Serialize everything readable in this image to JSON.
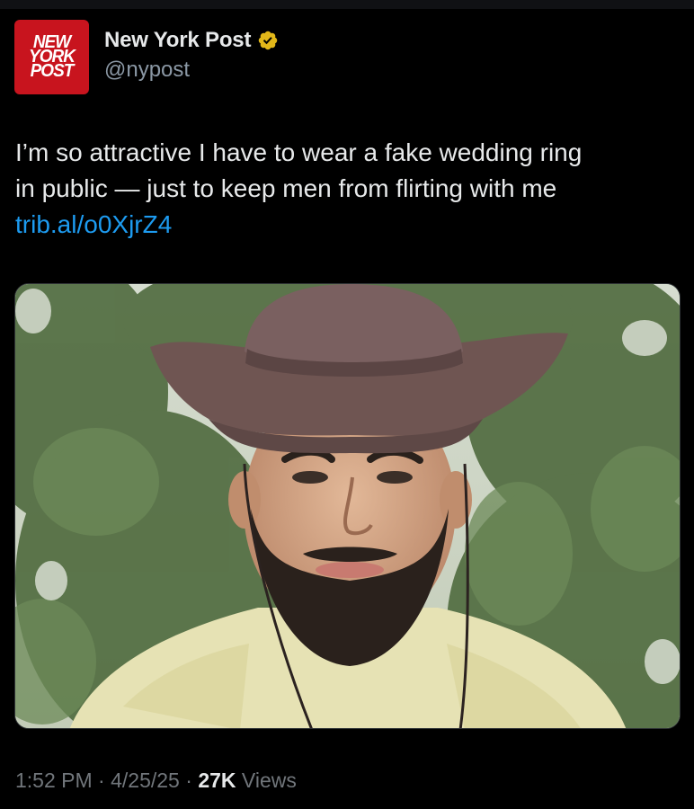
{
  "author": {
    "avatar_lines": [
      "NEW",
      "YORK",
      "POST"
    ],
    "display_name": "New York Post",
    "handle": "@nypost",
    "verified_icon": "verified-badge-gold",
    "avatar_color": "#c8141e"
  },
  "tweet": {
    "text_lines": [
      "I’m so attractive I have to wear a fake wedding ring",
      "in public — just to keep men from flirting with me"
    ],
    "link": "trib.al/o0XjrZ4"
  },
  "meta": {
    "time": "1:52 PM",
    "date": "4/25/25",
    "separator": "·",
    "views_count": "27K",
    "views_label": "Views"
  },
  "colors": {
    "background": "#000000",
    "text": "#e7e9ea",
    "secondary": "#71767b",
    "link": "#1d9bf0",
    "verified_gold": "#e2b719"
  }
}
